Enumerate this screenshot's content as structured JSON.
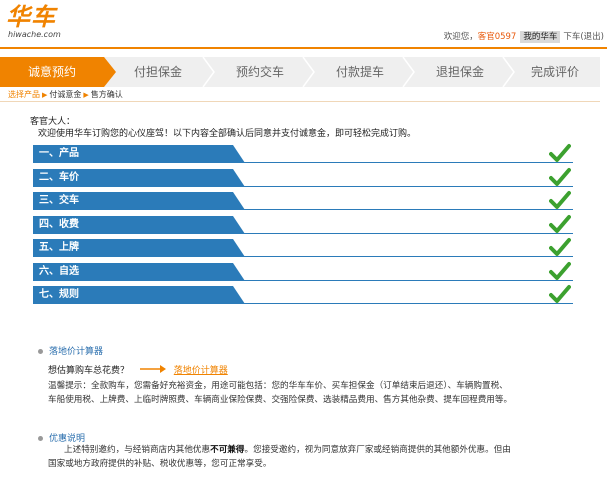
{
  "header": {
    "logo_text": "华车",
    "logo_sub": "hiwache.com",
    "welcome": "欢迎您，",
    "username": "客官0597",
    "my_car": "我的华车",
    "logout": "下车(退出)"
  },
  "steps": [
    {
      "label": "诚意预约",
      "active": true
    },
    {
      "label": "付担保金",
      "active": false
    },
    {
      "label": "预约交车",
      "active": false
    },
    {
      "label": "付款提车",
      "active": false
    },
    {
      "label": "退担保金",
      "active": false
    },
    {
      "label": "完成评价",
      "active": false
    }
  ],
  "breadcrumb": {
    "items": [
      "选择产品",
      "付诚意金",
      "售方确认"
    ],
    "separator": "▶"
  },
  "intro": {
    "greeting": "客官大人：",
    "welcome": "欢迎使用华车订购您的心仪座驾！以下内容全部确认后同意并支付诚意金，即可轻松完成订购。"
  },
  "sections": [
    {
      "label": "一、产品",
      "checked": true
    },
    {
      "label": "二、车价",
      "checked": true
    },
    {
      "label": "三、交车",
      "checked": true
    },
    {
      "label": "四、收费",
      "checked": true
    },
    {
      "label": "五、上牌",
      "checked": true
    },
    {
      "label": "六、自选",
      "checked": true
    },
    {
      "label": "七、规则",
      "checked": true
    }
  ],
  "calculator": {
    "title": "落地价计算器",
    "question": "想估算购车总花费？",
    "link": "落地价计算器",
    "tip_line1": "温馨提示：全款购车，您需备好充裕资金，用途可能包括：您的华车车价、买车担保金（订单结束后退还）、车辆购置税、",
    "tip_line2": "车船使用税、上牌费、上临时牌照费、车辆商业保险保费、交强险保费、选装精品费用、售方其他杂费、提车回程费用等。"
  },
  "discount": {
    "title": "优惠说明",
    "line1_pre": "上述特别邀约，与经销商店内其他优惠",
    "line1_bold": "不可兼得",
    "line1_post": "。您接受邀约，视为同意放弃厂家或经销商提供的其他额外优惠。但由",
    "line2": "国家或地方政府提供的补贴、税收优惠等，您可正常享受。"
  },
  "colors": {
    "brand_orange": "#f08300",
    "bar_blue": "#2b7bb9",
    "check_green": "#3ca12f",
    "link_blue": "#2b6fae"
  }
}
